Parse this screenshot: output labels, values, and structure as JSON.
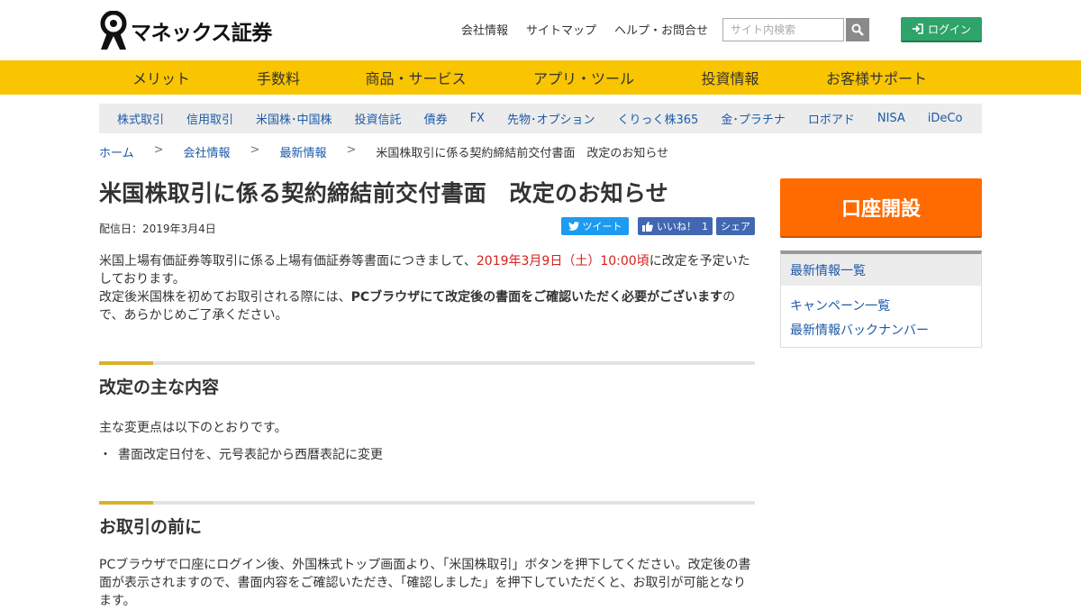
{
  "brand": {
    "name": "マネックス証券",
    "accent": "#f9c400"
  },
  "top_links": [
    "会社情報",
    "サイトマップ",
    "ヘルプ・お問合せ"
  ],
  "search": {
    "placeholder": "サイト内検索",
    "icon": "search-icon"
  },
  "login": {
    "label": "ログイン",
    "icon": "login-icon"
  },
  "main_nav": [
    "メリット",
    "手数料",
    "商品・サービス",
    "アプリ・ツール",
    "投資情報",
    "お客様サポート"
  ],
  "sub_nav": [
    "株式取引",
    "信用取引",
    "米国株･中国株",
    "投資信託",
    "債券",
    "FX",
    "先物･オプション",
    "くりっく株365",
    "金･プラチナ",
    "ロボアド",
    "NISA",
    "iDeCo"
  ],
  "breadcrumb": [
    "ホーム",
    "会社情報",
    "最新情報",
    "米国株取引に係る契約締結前交付書面　改定のお知らせ"
  ],
  "breadcrumb_sep": ">",
  "article": {
    "title": "米国株取引に係る契約締結前交付書面　改定のお知らせ",
    "date": "配信日：2019年3月4日",
    "share": {
      "tweet": "ツイート",
      "like": "いいね！",
      "like_count": "1",
      "share": "シェア"
    },
    "intro_1a": "米国上場有価証券等取引に係る上場有価証券等書面につきまして、",
    "intro_1_red": "2019年3月9日（土）10:00頃",
    "intro_1b": "に改定を予定いたしております。",
    "intro_2a": "改定後米国株を初めてお取引される際には、",
    "intro_2_bold": "PCブラウザにて改定後の書面をご確認いただく必要がございます",
    "intro_2b": "ので、あらかじめご了承ください。",
    "sections": [
      {
        "title": "改定の主な内容",
        "text": "主な変更点は以下のとおりです。",
        "bullets": [
          "書面改定日付を、元号表記から西暦表記に変更"
        ]
      },
      {
        "title": "お取引の前に",
        "text": "PCブラウザで口座にログイン後、外国株式トップ画面より、「米国株取引」ボタンを押下してください。改定後の書面が表示されますので、書面内容をご確認いただき、「確認しました」を押下していただくと、お取引が可能となります。"
      }
    ]
  },
  "sidebar": {
    "open_account": "口座開設",
    "box_title": "最新情報一覧",
    "links": [
      "キャンペーン一覧",
      "最新情報バックナンバー"
    ]
  }
}
